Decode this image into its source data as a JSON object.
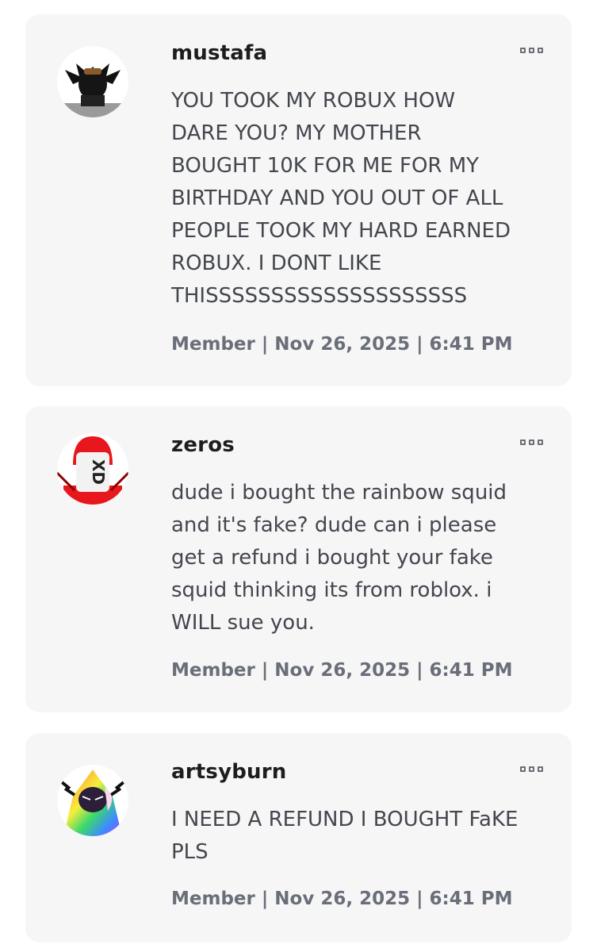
{
  "comments": [
    {
      "username": "mustafa",
      "body": "YOU TOOK MY ROBUX HOW\nDARE YOU? MY MOTHER\nBOUGHT 10K FOR ME FOR MY\nBIRTHDAY AND YOU OUT OF ALL\nPEOPLE TOOK MY HARD EARNED\nROBUX. I DONT LIKE\nTHISSSSSSSSSSSSSSSSSSSS",
      "meta": "Member | Nov 26, 2025 | 6:41 PM"
    },
    {
      "username": "zeros",
      "avatar_text": "XD",
      "body": "dude i bought the rainbow squid\nand it's fake? dude can i please\nget a refund i bought your fake\nsquid thinking its from roblox. i\nWILL sue you.",
      "meta": "Member | Nov 26, 2025 | 6:41 PM"
    },
    {
      "username": "artsyburn",
      "body": "I NEED A REFUND I BOUGHT FaKE\nPLS",
      "meta": "Member | Nov 26, 2025 | 6:41 PM"
    }
  ],
  "icons": {
    "more": "more-options-icon"
  },
  "colors": {
    "card_bg": "#f6f6f7",
    "username": "#1d1d20",
    "body": "#43464d",
    "meta": "#6a6e78"
  }
}
